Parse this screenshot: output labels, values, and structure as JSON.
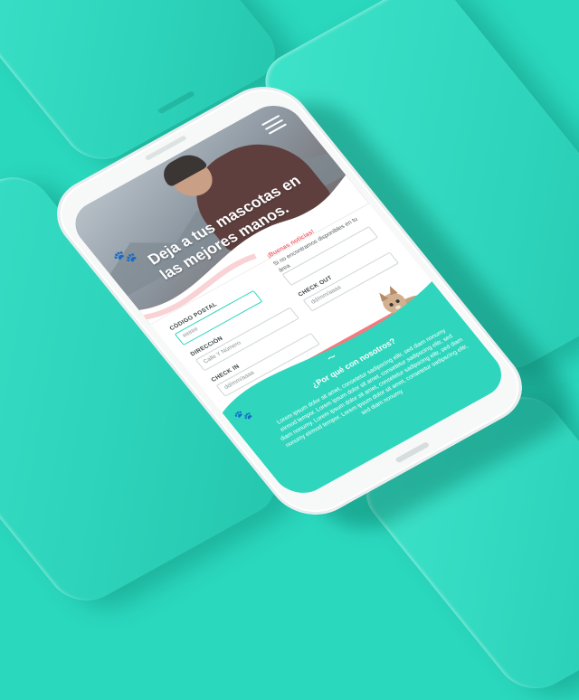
{
  "hero": {
    "title": "Deja a tus mascotas en las mejores manos.",
    "logo_icon": "paw-icon",
    "menu_icon": "hamburger-menu-icon"
  },
  "news": {
    "title": "¡Buenas noticias!",
    "text": "Si no encontramos disponibles en tu área"
  },
  "form": {
    "postal_label": "CÓDIGO POSTAL",
    "postal_placeholder": "#####",
    "address_label": "DIRECCIÓN",
    "address_placeholder": "Calle Y Número",
    "checkout_label": "CHECK OUT",
    "checkout_placeholder": "dd/mm/aaaa",
    "checkin_label": "CHECK IN",
    "checkin_placeholder": "dd/mm/aaaa",
    "submit_label": "Apartar"
  },
  "why": {
    "title": "¿Por qué con nosotros?",
    "text": "Lorem ipsum dolor sit amet, consetetur sadipscing elitr, sed diam nonumy eirmod tempor. Lorem ipsum dolor sit amet, consetetur sadipscing elitr, sed diam nonumy. Lorem ipsum dolor sit amet, consetetur sadipscing elitr, sed diam nonumy eirmod tempor. Lorem ipsum dolor sit amet, consetetur sadipscing elitr, sed diam nonumy"
  },
  "colors": {
    "background": "#2ad8be",
    "accent_teal": "#2fd6bd",
    "accent_coral": "#f27b7f",
    "news_red": "#ef6b73"
  }
}
